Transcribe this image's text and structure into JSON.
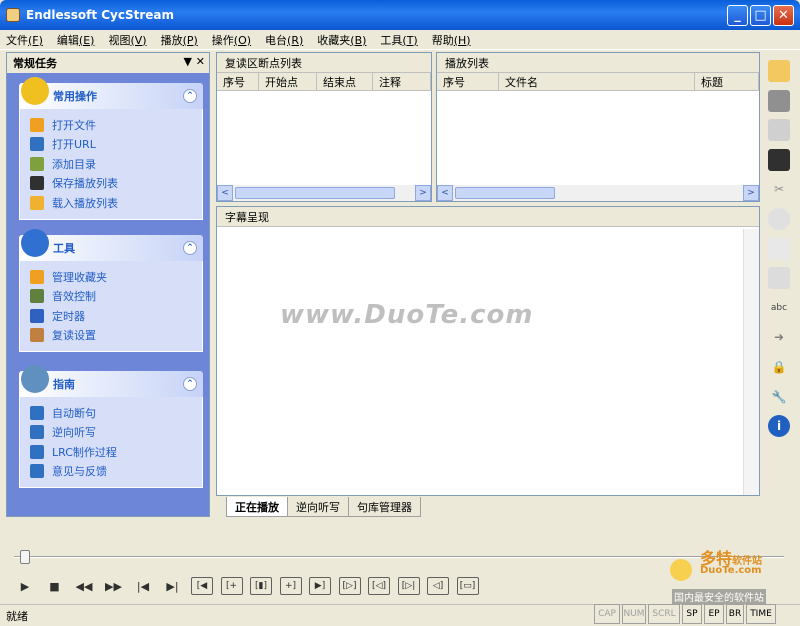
{
  "window": {
    "title": "Endlessoft CycStream",
    "minimize": "_",
    "maximize": "□",
    "close": "✕"
  },
  "menu": [
    {
      "label": "文件",
      "key": "(F)"
    },
    {
      "label": "编辑",
      "key": "(E)"
    },
    {
      "label": "视图",
      "key": "(V)"
    },
    {
      "label": "播放",
      "key": "(P)"
    },
    {
      "label": "操作",
      "key": "(O)"
    },
    {
      "label": "电台",
      "key": "(R)"
    },
    {
      "label": "收藏夹",
      "key": "(B)"
    },
    {
      "label": "工具",
      "key": "(T)"
    },
    {
      "label": "帮助",
      "key": "(H)"
    }
  ],
  "taskpane": {
    "title": "常规任务",
    "arrow": "▼",
    "close": "✕",
    "groups": [
      {
        "title": "常用操作",
        "toggle": "⌃",
        "items": [
          "打开文件",
          "打开URL",
          "添加目录",
          "保存播放列表",
          "载入播放列表"
        ]
      },
      {
        "title": "工具",
        "toggle": "⌃",
        "items": [
          "管理收藏夹",
          "音效控制",
          "定时器",
          "复读设置"
        ]
      },
      {
        "title": "指南",
        "toggle": "⌃",
        "items": [
          "自动断句",
          "逆向听写",
          "LRC制作过程",
          "意见与反馈"
        ]
      }
    ]
  },
  "breakpoints": {
    "title": "复读区断点列表",
    "columns": [
      "序号",
      "开始点",
      "结束点",
      "注释"
    ]
  },
  "playlist": {
    "title": "播放列表",
    "columns": [
      "序号",
      "文件名",
      "标题"
    ]
  },
  "subtitle": {
    "title": "字幕呈现"
  },
  "tabs": [
    "正在播放",
    "逆向听写",
    "句库管理器"
  ],
  "watermark": "www.DuoTe.com",
  "watermark2": {
    "brand": "多特",
    "tagline": "软件站",
    "site": "DuoTe.com",
    "slogan": "国内最安全的软件站"
  },
  "status": {
    "text": "就绪",
    "indicators": [
      "CAP",
      "NUM",
      "SCRL",
      "SP",
      "EP",
      "BR",
      "TIME"
    ]
  },
  "colors": {
    "title": "#0a5fd8",
    "pane": "#6d86d8",
    "link": "#215dc6"
  }
}
